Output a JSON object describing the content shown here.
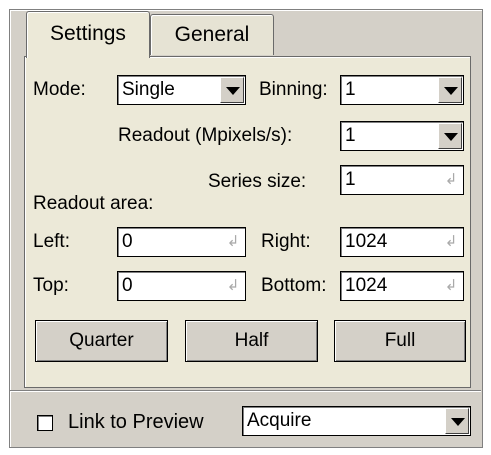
{
  "tabs": [
    {
      "label": "Settings",
      "active": true
    },
    {
      "label": "General",
      "active": false
    }
  ],
  "settings": {
    "mode_label": "Mode:",
    "mode_value": "Single",
    "binning_label": "Binning:",
    "binning_value": "1",
    "readout_label": "Readout (Mpixels/s):",
    "readout_value": "1",
    "series_label": "Series size:",
    "series_value": "1",
    "area_label": "Readout area:",
    "left_label": "Left:",
    "left_value": "0",
    "right_label": "Right:",
    "right_value": "1024",
    "top_label": "Top:",
    "top_value": "0",
    "bottom_label": "Bottom:",
    "bottom_value": "1024",
    "buttons": {
      "quarter": "Quarter",
      "half": "Half",
      "full": "Full"
    }
  },
  "footer": {
    "link_label": "Link to Preview",
    "link_checked": false,
    "action_value": "Acquire"
  },
  "colors": {
    "panel": "#d4d0c8",
    "tab_body": "#ece9d8"
  },
  "icons": {
    "dropdown": "chevron-down-icon",
    "enter": "enter-icon"
  }
}
